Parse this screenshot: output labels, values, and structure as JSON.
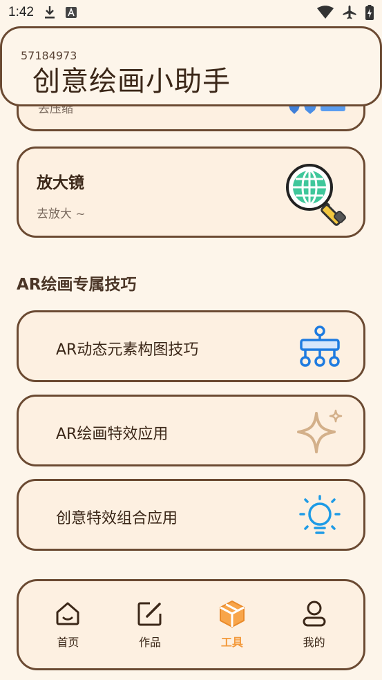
{
  "status_bar": {
    "time": "1:42"
  },
  "header": {
    "id_text": "57184973",
    "title": "创意绘画小助手"
  },
  "partial_card": {
    "subtitle": "去压缩"
  },
  "magnifier_card": {
    "title": "放大镜",
    "subtitle": "去放大 ~"
  },
  "section": {
    "title": "AR绘画专属技巧"
  },
  "tips": [
    {
      "label": "AR动态元素构图技巧",
      "icon": "hierarchy-icon"
    },
    {
      "label": "AR绘画特效应用",
      "icon": "sparkle-icon"
    },
    {
      "label": "创意特效组合应用",
      "icon": "lightbulb-icon"
    }
  ],
  "nav": {
    "items": [
      {
        "label": "首页",
        "icon": "home-icon"
      },
      {
        "label": "作品",
        "icon": "edit-icon"
      },
      {
        "label": "工具",
        "icon": "box-icon",
        "active": true
      },
      {
        "label": "我的",
        "icon": "user-icon"
      }
    ]
  },
  "colors": {
    "border": "#6b4a32",
    "background": "#fdf5ea",
    "card": "#fdf0e1",
    "accent": "#f39a3c",
    "tip_blue": "#1e7be0"
  }
}
